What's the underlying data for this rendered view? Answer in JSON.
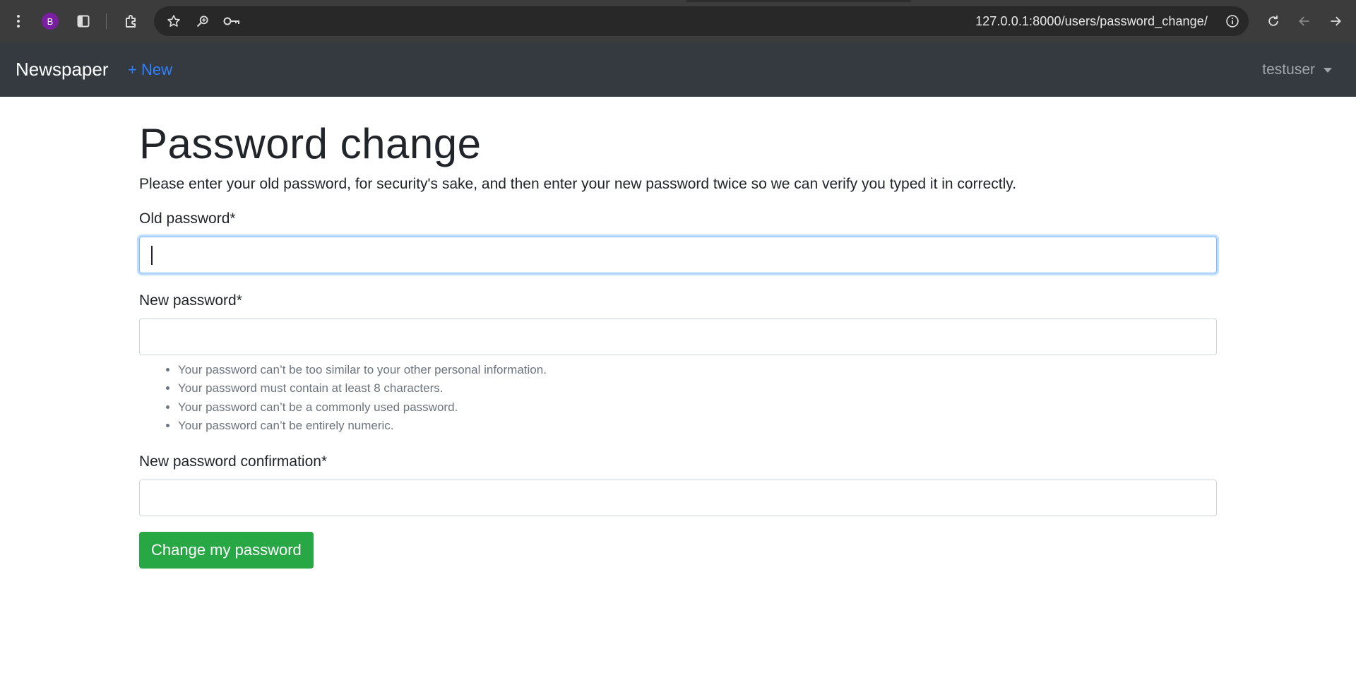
{
  "browser": {
    "profile_initial": "B",
    "url": "127.0.0.1:8000/users/password_change/"
  },
  "navbar": {
    "brand": "Newspaper",
    "new_link": "+ New",
    "user": "testuser"
  },
  "page": {
    "title": "Password change",
    "intro": "Please enter your old password, for security's sake, and then enter your new password twice so we can verify you typed it in correctly."
  },
  "form": {
    "old_password_label": "Old password*",
    "old_password_value": "",
    "new_password_label": "New password*",
    "new_password_value": "",
    "help_items": [
      "Your password can’t be too similar to your other personal information.",
      "Your password must contain at least 8 characters.",
      "Your password can’t be a commonly used password.",
      "Your password can’t be entirely numeric."
    ],
    "confirm_label": "New password confirmation*",
    "confirm_value": "",
    "submit_label": "Change my password"
  },
  "colors": {
    "navbar_bg": "#343a40",
    "link": "#2f80ff",
    "submit_bg": "#28a745",
    "focus_border": "#80bdff",
    "avatar_bg": "#7b1fa2"
  },
  "icons": [
    "menu-dots-icon",
    "side-panel-icon",
    "extensions-icon",
    "star-icon",
    "zoom-icon",
    "password-key-icon",
    "site-info-icon",
    "reload-icon",
    "back-icon",
    "forward-icon"
  ]
}
